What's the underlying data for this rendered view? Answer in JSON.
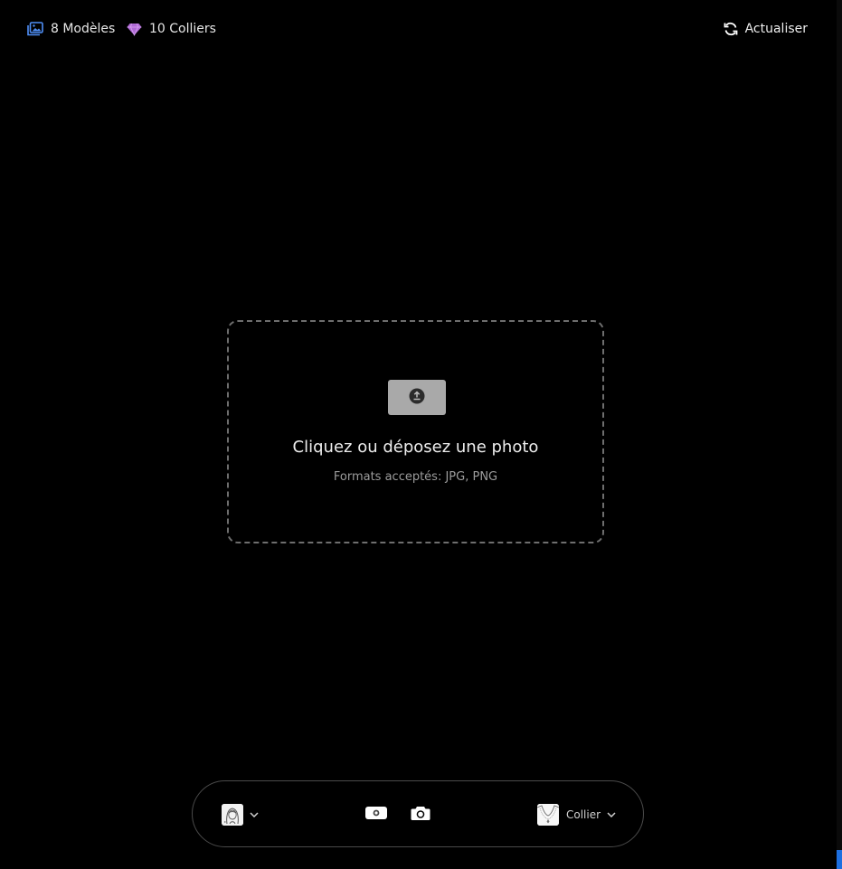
{
  "header": {
    "models_count": "8 Modèles",
    "models_icon": "images-icon",
    "collars_count": "10 Colliers",
    "collars_icon": "gem-icon",
    "refresh_label": "Actualiser",
    "refresh_icon": "refresh-icon"
  },
  "upload": {
    "icon": "upload-icon",
    "title": "Cliquez ou déposez une photo",
    "subtitle": "Formats acceptés: JPG, PNG"
  },
  "toolbar": {
    "model_thumb_icon": "woman-portrait-icon",
    "switch_camera_icon": "switch-camera-icon",
    "capture_icon": "camera-icon",
    "collar_thumb_icon": "necklace-icon",
    "collar_label": "Collier"
  },
  "colors": {
    "background": "#000000",
    "accent_blue": "#4f8ff7",
    "gem_purple": "#b06ad6",
    "dashed_border": "#6e6e6e",
    "upload_badge": "#a9a9a9"
  }
}
